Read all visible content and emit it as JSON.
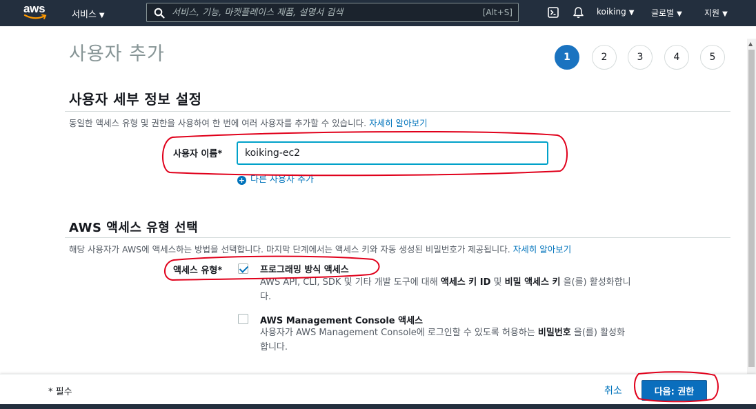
{
  "topbar": {
    "logo": "aws",
    "services": "서비스",
    "search_placeholder": "서비스, 기능, 마켓플레이스 제품, 설명서 검색",
    "search_shortcut": "[Alt+S]",
    "user": "koiking",
    "region": "글로벌",
    "support": "지원"
  },
  "page": {
    "title": "사용자 추가",
    "steps": [
      "1",
      "2",
      "3",
      "4",
      "5"
    ],
    "active_step": 1
  },
  "details": {
    "heading": "사용자 세부 정보 설정",
    "description": "동일한 액세스 유형 및 권한을 사용하여 한 번에 여러 사용자를 추가할 수 있습니다.",
    "learn_more": "자세히 알아보기",
    "username_label": "사용자 이름*",
    "username_value": "koiking-ec2",
    "add_another": "다른 사용자 추가"
  },
  "access": {
    "heading": "AWS 액세스 유형 선택",
    "description": "해당 사용자가 AWS에 액세스하는 방법을 선택합니다. 마지막 단계에서는 액세스 키와 자동 생성된 비밀번호가 제공됩니다.",
    "learn_more": "자세히 알아보기",
    "label": "액세스 유형*",
    "options": [
      {
        "title": "프로그래밍 방식 액세스",
        "checked": true,
        "desc_a": "AWS API, CLI, SDK 및 기타 개발 도구에 대해 ",
        "desc_b": "액세스 키 ID",
        "desc_c": " 및 ",
        "desc_d": "비밀 액세스 키",
        "desc_e": " 을(를) 활성화합니다."
      },
      {
        "title": "AWS Management Console 액세스",
        "checked": false,
        "desc_a": "사용자가 AWS Management Console에 로그인할 수 있도록 허용하는 ",
        "desc_b": "비밀번호",
        "desc_c": " 을(를) 활성화합니다."
      }
    ]
  },
  "footer": {
    "required_note": "* 필수",
    "cancel": "취소",
    "next": "다음: 권한"
  },
  "colors": {
    "nav_bg": "#232f3e",
    "accent": "#0073bb",
    "step_active": "#1a73c0",
    "annotation_red": "#e0001b"
  }
}
